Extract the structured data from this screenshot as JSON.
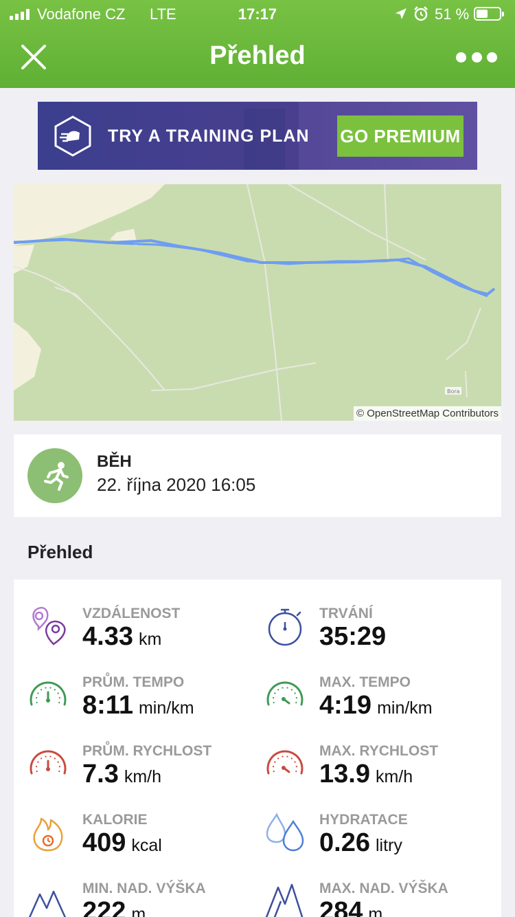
{
  "status_bar": {
    "carrier": "Vodafone CZ",
    "network": "LTE",
    "time": "17:17",
    "battery": "51 %"
  },
  "header": {
    "title": "Přehled",
    "close_icon": "close-icon",
    "more_icon": "more-icon"
  },
  "banner": {
    "text": "TRY A TRAINING PLAN",
    "button": "GO PREMIUM"
  },
  "map": {
    "credit": "© OpenStreetMap Contributors",
    "place_label": "Bora"
  },
  "activity": {
    "type": "BĚH",
    "date": "22. října 2020 16:05"
  },
  "summary": {
    "title": "Přehled",
    "stats": [
      {
        "label": "VZDÁLENOST",
        "value": "4.33",
        "unit": "km",
        "icon": "location-pins-icon",
        "color": "#8a4fb0"
      },
      {
        "label": "TRVÁNÍ",
        "value": "35:29",
        "unit": "",
        "icon": "stopwatch-icon",
        "color": "#3d4f9e"
      },
      {
        "label": "PRŮM. TEMPO",
        "value": "8:11",
        "unit": "min/km",
        "icon": "speedometer-icon",
        "color": "#3f9a55"
      },
      {
        "label": "MAX. TEMPO",
        "value": "4:19",
        "unit": "min/km",
        "icon": "speedometer-icon",
        "color": "#3f9a55"
      },
      {
        "label": "PRŮM. RYCHLOST",
        "value": "7.3",
        "unit": "km/h",
        "icon": "speedometer-icon",
        "color": "#c94a3f"
      },
      {
        "label": "MAX. RYCHLOST",
        "value": "13.9",
        "unit": "km/h",
        "icon": "speedometer-icon",
        "color": "#c94a3f"
      },
      {
        "label": "KALORIE",
        "value": "409",
        "unit": "kcal",
        "icon": "flame-icon",
        "color": "#e8a13a"
      },
      {
        "label": "HYDRATACE",
        "value": "0.26",
        "unit": "litry",
        "icon": "water-drops-icon",
        "color": "#4f7fd6"
      },
      {
        "label": "MIN. NAD. VÝŠKA",
        "value": "222",
        "unit": "m",
        "icon": "mountain-icon",
        "color": "#3d4f9e"
      },
      {
        "label": "MAX. NAD. VÝŠKA",
        "value": "284",
        "unit": "m",
        "icon": "mountain-icon",
        "color": "#3d4f9e"
      }
    ]
  }
}
